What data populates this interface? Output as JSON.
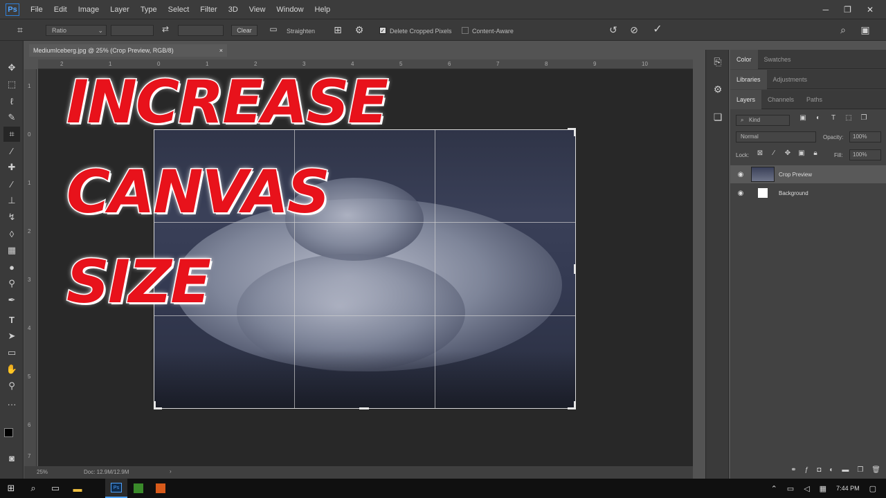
{
  "app": {
    "logo": "Ps",
    "menu": [
      "File",
      "Edit",
      "Image",
      "Layer",
      "Type",
      "Select",
      "Filter",
      "3D",
      "View",
      "Window",
      "Help"
    ],
    "window_controls": [
      "─",
      "❐",
      "✕"
    ]
  },
  "options_bar": {
    "ratio_label": "Ratio",
    "clear_label": "Clear",
    "straighten_label": "Straighten",
    "delete_cropped_label": "Delete Cropped Pixels",
    "delete_cropped_checked": true,
    "content_aware_label": "Content-Aware",
    "content_aware_checked": false
  },
  "document": {
    "tab_title": "MediumIceberg.jpg @ 25% (Crop Preview, RGB/8)",
    "ruler_top_ticks": [
      "2",
      "1",
      "0",
      "1",
      "2",
      "3",
      "4",
      "5",
      "6",
      "7",
      "8",
      "9",
      "10"
    ],
    "ruler_left_ticks": [
      "1",
      "0",
      "1",
      "2",
      "3",
      "4",
      "5",
      "6",
      "7"
    ],
    "zoom": "25%",
    "doc_info": "Doc: 12.9M/12.9M"
  },
  "overlay_title": {
    "line1": "INCREASE",
    "line2": "CANVAS",
    "line3": "SIZE"
  },
  "panels": {
    "row1": {
      "tabs": [
        "Color",
        "Swatches"
      ],
      "active": 0
    },
    "row2": {
      "tabs": [
        "Libraries",
        "Adjustments"
      ],
      "active": 0
    },
    "row3": {
      "tabs": [
        "Layers",
        "Channels",
        "Paths"
      ],
      "active": 0
    },
    "kind_label": "Kind",
    "blend_mode": "Normal",
    "opacity_label": "Opacity:",
    "opacity_value": "100%",
    "lock_label": "Lock:",
    "fill_label": "Fill:",
    "fill_value": "100%",
    "layers": [
      {
        "name": "Crop Preview",
        "visible": true,
        "selected": true
      },
      {
        "name": "Background",
        "visible": true,
        "selected": false
      }
    ]
  },
  "taskbar": {
    "time": "7:44 PM"
  },
  "colors": {
    "accent_red": "#e8121b",
    "ps_blue": "#4fa3ff"
  }
}
